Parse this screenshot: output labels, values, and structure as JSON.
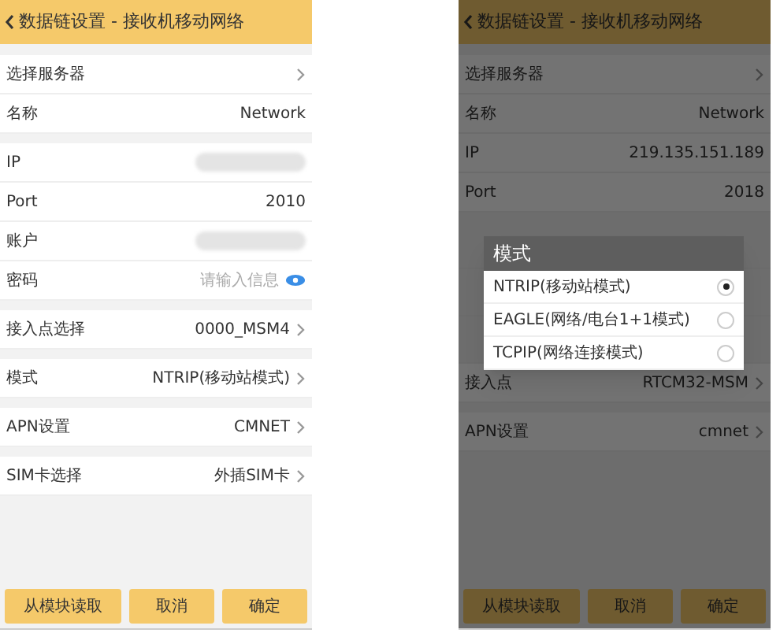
{
  "screens": [
    {
      "title": "数据链设置 - 接收机移动网络",
      "dimmed": false,
      "groups": [
        [
          {
            "kind": "chevron",
            "label": "选择服务器"
          },
          {
            "kind": "text",
            "label": "名称",
            "value": "Network"
          }
        ],
        [
          {
            "kind": "blurred",
            "label": "IP"
          },
          {
            "kind": "text",
            "label": "Port",
            "value": "2010"
          },
          {
            "kind": "blurred",
            "label": "账户"
          },
          {
            "kind": "password",
            "label": "密码",
            "placeholder": "请输入信息"
          }
        ],
        [
          {
            "kind": "chevron",
            "label": "接入点选择",
            "value": "0000_MSM4"
          }
        ],
        [
          {
            "kind": "chevron",
            "label": "模式",
            "value": "NTRIP(移动站模式)"
          }
        ],
        [
          {
            "kind": "chevron",
            "label": "APN设置",
            "value": "CMNET"
          }
        ],
        [
          {
            "kind": "chevron",
            "label": "SIM卡选择",
            "value": "外插SIM卡"
          }
        ]
      ],
      "buttons": [
        "从模块读取",
        "取消",
        "确定"
      ]
    },
    {
      "title": "数据链设置 - 接收机移动网络",
      "dimmed": true,
      "groups": [
        [
          {
            "kind": "chevron",
            "label": "选择服务器"
          },
          {
            "kind": "text",
            "label": "名称",
            "value": "Network"
          },
          {
            "kind": "text",
            "label": "IP",
            "value": "219.135.151.189"
          },
          {
            "kind": "text",
            "label": "Port",
            "value": "2018"
          }
        ],
        [
          {
            "kind": "hidden"
          },
          {
            "kind": "hidden"
          },
          {
            "kind": "hidden"
          },
          {
            "kind": "chevron",
            "label": "接入点",
            "value": "RTCM32-MSM"
          }
        ],
        [
          {
            "kind": "chevron",
            "label": "APN设置",
            "value": "cmnet"
          }
        ]
      ],
      "buttons": [
        "从模块读取",
        "取消",
        "确定"
      ],
      "dialog": {
        "title": "模式",
        "options": [
          {
            "label": "NTRIP(移动站模式)",
            "selected": true
          },
          {
            "label": "EAGLE(网络/电台1+1模式)",
            "selected": false
          },
          {
            "label": "TCPIP(网络连接模式)",
            "selected": false
          }
        ]
      }
    }
  ]
}
